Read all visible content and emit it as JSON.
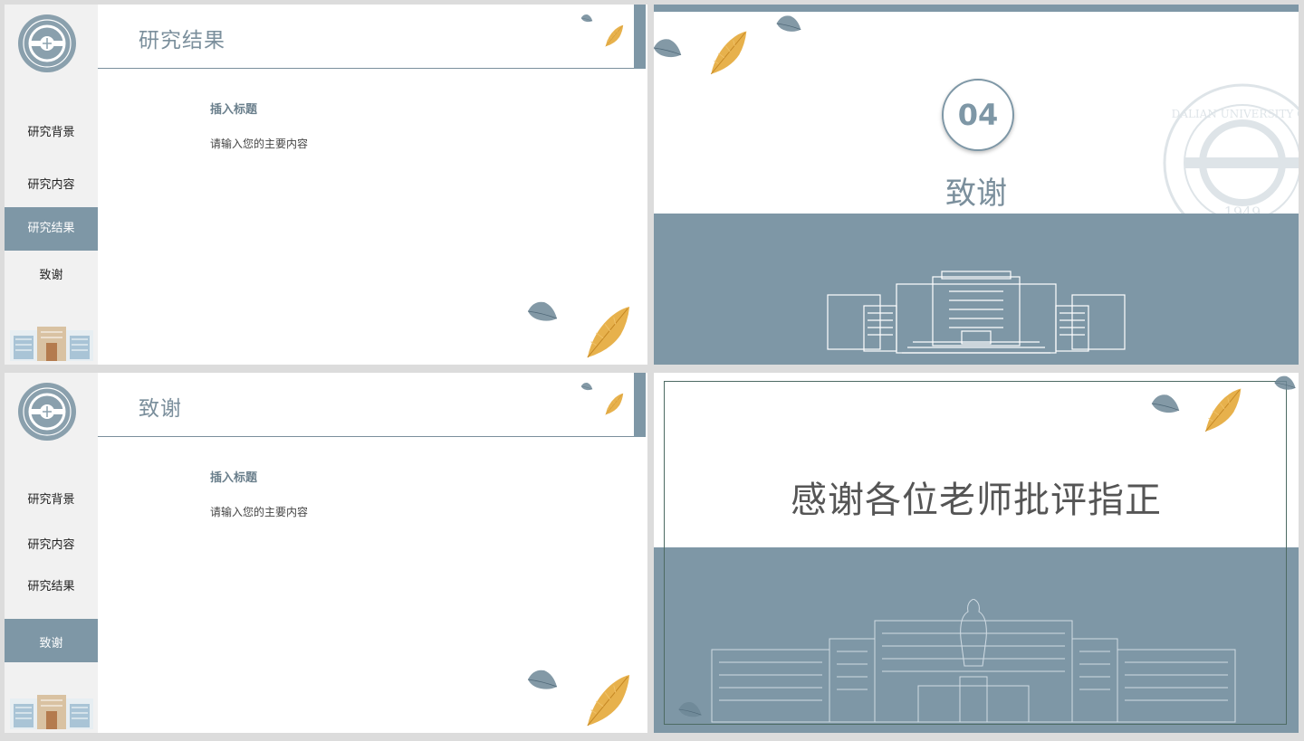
{
  "slide1": {
    "header_title": "研究结果",
    "nav": [
      "研究背景",
      "研究内容",
      "研究结果",
      "致谢"
    ],
    "subtitle": "插入标题",
    "body": "请输入您的主要内容"
  },
  "slide2": {
    "number": "04",
    "title": "致谢",
    "seal_text": "DALIAN UNIVERSITY OF",
    "seal_year": "1949"
  },
  "slide3": {
    "header_title": "致谢",
    "nav": [
      "研究背景",
      "研究内容",
      "研究结果",
      "致谢"
    ],
    "subtitle": "插入标题",
    "body": "请输入您的主要内容"
  },
  "slide4": {
    "title": "感谢各位老师批评指正"
  },
  "colors": {
    "accent": "#7e97a6",
    "heading": "#7b8f9c",
    "leaf_orange": "#e2a536",
    "leaf_blue": "#6f8898"
  }
}
